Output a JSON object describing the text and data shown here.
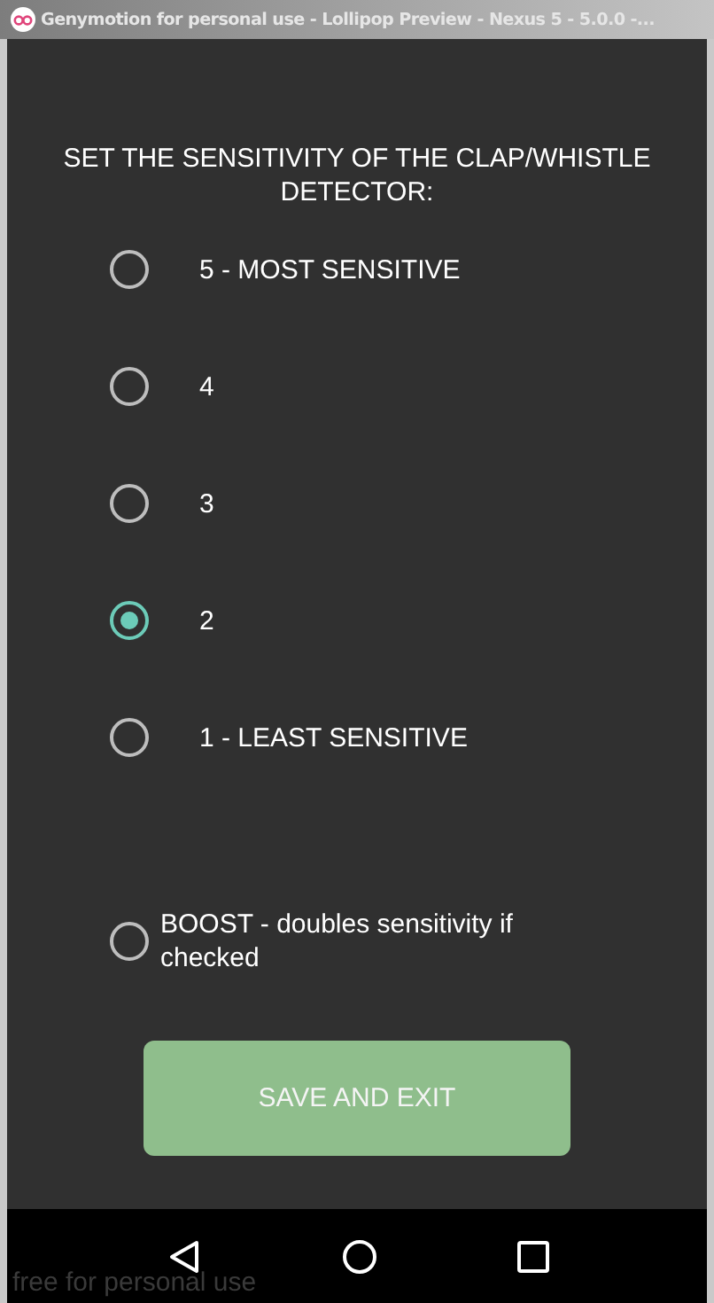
{
  "window": {
    "title": "Genymotion for personal use - Lollipop Preview - Nexus 5 - 5.0.0 -..."
  },
  "heading": "SET THE SENSITIVITY OF THE CLAP/WHISTLE DETECTOR:",
  "options": [
    {
      "label": "5 - MOST SENSITIVE",
      "selected": false
    },
    {
      "label": "4",
      "selected": false
    },
    {
      "label": "3",
      "selected": false
    },
    {
      "label": "2",
      "selected": true
    },
    {
      "label": "1 - LEAST SENSITIVE",
      "selected": false
    }
  ],
  "boost": {
    "label": "BOOST - doubles sensitivity if checked",
    "checked": false
  },
  "button": "SAVE AND EXIT",
  "overlay_text": "free for personal use"
}
